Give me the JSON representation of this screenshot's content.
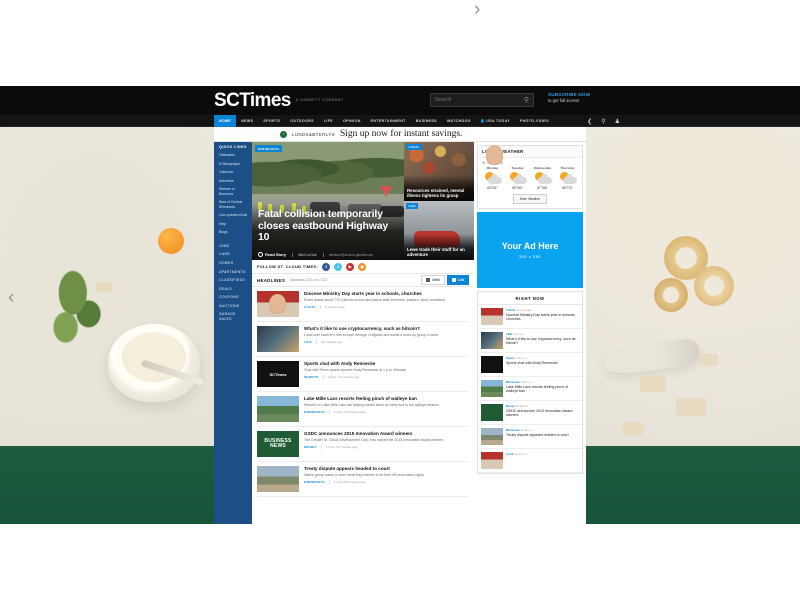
{
  "desktop": {
    "carousel_prev": "‹",
    "carousel_next": "›"
  },
  "header": {
    "logo": "SCTimes",
    "logo_tagline": "A GANNETT COMPANY",
    "search_placeholder": "Search",
    "search_value": "",
    "search_icon": "search-icon",
    "subscribe_line1": "SUBSCRIBE NOW",
    "subscribe_line2": "to get full access",
    "share_icon": "share-icon",
    "header_search_icon": "search-icon",
    "account_icon": "user-icon"
  },
  "nav": {
    "items": [
      {
        "label": "HOME",
        "active": true,
        "dot": false
      },
      {
        "label": "NEWS",
        "active": false,
        "dot": false
      },
      {
        "label": "SPORTS",
        "active": false,
        "dot": false
      },
      {
        "label": "OUTDOORS",
        "active": false,
        "dot": false
      },
      {
        "label": "LIFE",
        "active": false,
        "dot": false
      },
      {
        "label": "OPINION",
        "active": false,
        "dot": false
      },
      {
        "label": "ENTERTAINMENT",
        "active": false,
        "dot": false
      },
      {
        "label": "BUSINESS",
        "active": false,
        "dot": false
      },
      {
        "label": "WATCHDOG",
        "active": false,
        "dot": false
      },
      {
        "label": "USA TODAY",
        "active": false,
        "dot": true
      },
      {
        "label": "PHOTO-VIDEO",
        "active": false,
        "dot": false
      }
    ]
  },
  "promo": {
    "brand": "LUNDS&BYERLYS",
    "text": "Sign up now for instant savings."
  },
  "rail": {
    "title": "QUICK LINKS",
    "links": [
      "Obituaries",
      "E-Newspaper",
      "Calendar",
      "Advertise",
      "Women in Business",
      "Best of Central Minnesota",
      "Live updates/Chat",
      "Help",
      "Blogs"
    ],
    "caps": [
      "JOBS",
      "CARS",
      "HOMES",
      "APARTMENTS",
      "CLASSIFIEDS",
      "DEALS",
      "COUPONS",
      "AUCTIONS",
      "GARAGE SALES"
    ]
  },
  "hero": {
    "badge": "MINNESOTA",
    "title": "Fatal collision temporarily closes eastbound Highway 10",
    "read_story": "Read Story",
    "byline": "Mitch LeClair",
    "email": "mleclair2@stcloud.gannett.com",
    "cards": [
      {
        "badge": "LOCAL",
        "title": "Resources strained, mental illness tightens its grasp"
      },
      {
        "badge": "LIFE",
        "title": "Lewe trade their stuff for an adventure"
      }
    ]
  },
  "follow": {
    "label": "FOLLOW ST. CLOUD TIMES:",
    "icons": [
      {
        "name": "facebook-icon",
        "glyph": "f"
      },
      {
        "name": "twitter-icon",
        "glyph": "t"
      },
      {
        "name": "youtube-icon",
        "glyph": "▶"
      },
      {
        "name": "rss-icon",
        "glyph": "◉"
      }
    ]
  },
  "headlines": {
    "title": "HEADLINES",
    "updated": "Updated 2:13 p.m. CDT",
    "grid_label": "Grid",
    "list_label": "List",
    "items": [
      {
        "headline": "Diocese Ministry Day starts year in schools, churches",
        "dek": "Event draws about 770 Catholic school and parish staff members, pastors, other volunteers",
        "category": "LOCAL",
        "time": "9 minutes ago"
      },
      {
        "headline": "What's it like to use cryptocurrency, such as bitcoin?",
        "dek": "Local user said he's met a buyer through Craigslist and wants a meet-up group in area",
        "category": "LIFE",
        "time": "30 minutes ago"
      },
      {
        "headline": "Sports chat with Andy Rennecke",
        "dek": "Chat with Times sports reporter Andy Rennecke at 1 p.m. Monday",
        "category": "SPORTS",
        "time": "1 hour, 10 minutes ago"
      },
      {
        "headline": "Lake Mille Lacs resorts feeling pinch of walleye ban",
        "dek": "Resorts on Lake Mille Lacs are tallying losses since an early end to the walleye season",
        "category": "MINNESOTA",
        "time": "1 hour, 25 minutes ago"
      },
      {
        "headline": "GSDC announces 2015 Innovation Award winners",
        "dek": "The Greater St. Cloud Development Corp. has named the 2015 Innovation Award winners",
        "category": "MONEY",
        "time": "1 hour, 47 minutes ago"
      },
      {
        "headline": "Treaty dispute appears headed to court",
        "dek": "Native group wants to exert what they believe to be their off-reservation rights",
        "category": "MINNESOTA",
        "time": "1 hour, 55 minutes ago"
      }
    ]
  },
  "weather": {
    "title": "LOCAL WEATHER",
    "location": "St. Cloud, MN",
    "button": "More Weather",
    "days": [
      {
        "name": "Monday",
        "icon": "sun-cloud-icon",
        "temp": "83°/61°"
      },
      {
        "name": "Tuesday",
        "icon": "sun-cloud-icon",
        "temp": "85°/63°"
      },
      {
        "name": "Wednesday",
        "icon": "sun-cloud-icon",
        "temp": "87°/66°"
      },
      {
        "name": "Thursday",
        "icon": "sun-cloud-icon",
        "temp": "86°/70°"
      }
    ]
  },
  "ad": {
    "title": "Your Ad Here",
    "size": "300 x 250"
  },
  "right_now": {
    "title": "RIGHT NOW",
    "items": [
      {
        "category": "LOCAL",
        "time": "10 mins ago",
        "headline": "Diocese Ministry Day starts year in schools, churches"
      },
      {
        "category": "LIFE",
        "time": "1:47 p.m.",
        "headline": "What's it like to use cryptocurrency, such as bitcoin?"
      },
      {
        "category": "Sports",
        "time": "1:00 p.m.",
        "headline": "Sports chat with Andy Rennecke"
      },
      {
        "category": "Minnesota",
        "time": "12:57 p.m.",
        "headline": "Lake Mille Lacs resorts feeling pinch of walleye ban"
      },
      {
        "category": "Money",
        "time": "12:35 p.m.",
        "headline": "GSDC announces 2015 Innovation Award winners"
      },
      {
        "category": "Minnesota",
        "time": "12:25 p.m.",
        "headline": "Treaty dispute appears headed to court"
      },
      {
        "category": "Local",
        "time": "12:12 p.m.",
        "headline": ""
      }
    ]
  },
  "colors": {
    "accent_blue": "#0b84d6",
    "rail_blue": "#1b4f86",
    "ad_blue": "#0aa3f0",
    "bar_black": "#0b0b0b",
    "band_green": "#1d5c3f"
  }
}
